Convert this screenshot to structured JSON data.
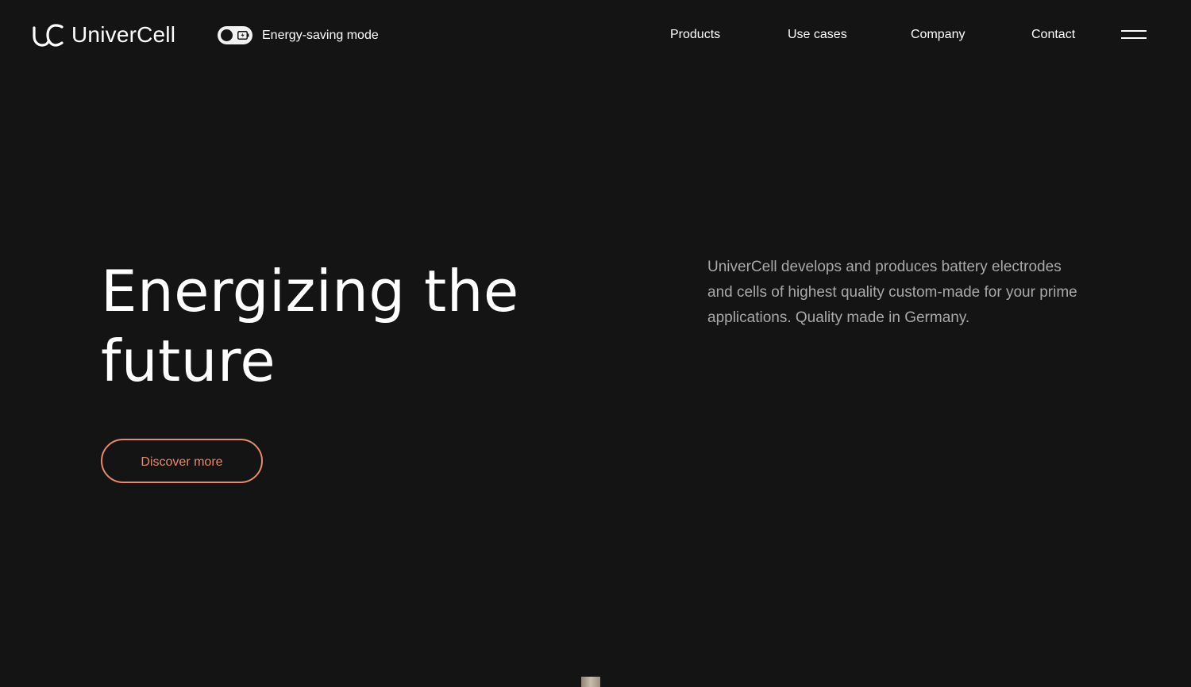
{
  "header": {
    "logo_text": "UniverCell",
    "energy_toggle_label": "Energy-saving mode",
    "nav": {
      "products": "Products",
      "use_cases": "Use cases",
      "company": "Company",
      "contact": "Contact"
    },
    "menu_icon": "hamburger-icon"
  },
  "hero": {
    "title_line1": "Energizing the",
    "title_line2": "future",
    "description": "UniverCell develops and produces battery electrodes and cells of highest quality custom-made for your prime applications. Quality made in Germany.",
    "cta_label": "Discover more"
  },
  "colors": {
    "background": "#141414",
    "text": "#ffffff",
    "muted_text": "#a9a9a9",
    "accent": "#e58b6e"
  }
}
